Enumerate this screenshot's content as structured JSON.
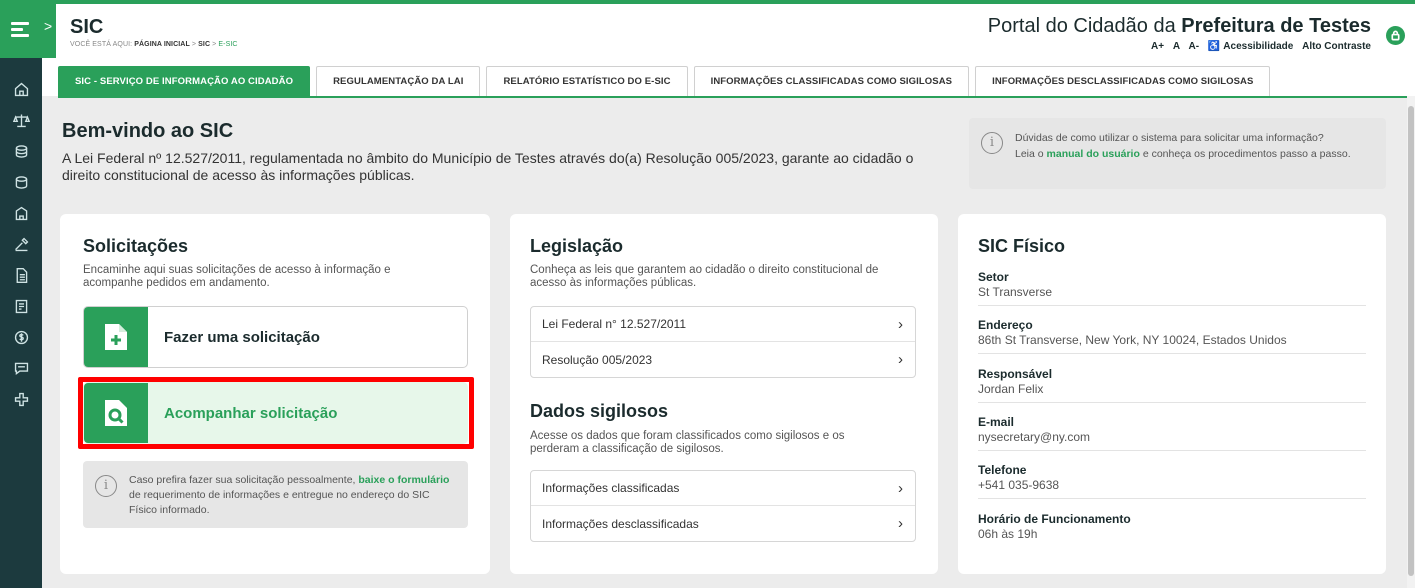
{
  "header": {
    "title": "SIC",
    "breadcrumb_prefix": "VOCÊ ESTÁ AQUI:",
    "breadcrumb_home": "PÁGINA INICIAL",
    "breadcrumb_sep": ">",
    "breadcrumb_sic": "SIC",
    "breadcrumb_current": "E-SIC",
    "portal_prefix": "Portal do Cidadão da",
    "portal_name": "Prefeitura de Testes",
    "a_plus": "A+",
    "a_normal": "A",
    "a_minus": "A-",
    "acc_icon": "♿",
    "accessibility": "Acessibilidade",
    "contrast": "Alto Contraste"
  },
  "tabs": [
    {
      "label": "SIC - SERVIÇO DE INFORMAÇÃO AO CIDADÃO"
    },
    {
      "label": "REGULAMENTAÇÃO DA LAI"
    },
    {
      "label": "RELATÓRIO ESTATÍSTICO DO E-SIC"
    },
    {
      "label": "INFORMAÇÕES CLASSIFICADAS COMO SIGILOSAS"
    },
    {
      "label": "INFORMAÇÕES DESCLASSIFICADAS COMO SIGILOSAS"
    }
  ],
  "welcome": {
    "title": "Bem-vindo ao SIC",
    "text": "A Lei Federal nº 12.527/2011, regulamentada no âmbito do Município de Testes através do(a) Resolução 005/2023, garante ao cidadão o direito constitucional de acesso às informações públicas."
  },
  "help": {
    "line1": "Dúvidas de como utilizar o sistema para solicitar uma informação?",
    "leia": "Leia o",
    "link": "manual do usuário",
    "rest": "e conheça os procedimentos passo a passo."
  },
  "solicitacoes": {
    "title": "Solicitações",
    "desc1": "Encaminhe aqui suas solicitações de acesso à informação e",
    "desc2": "acompanhe pedidos em andamento.",
    "action1": "Fazer uma solicitação",
    "action2": "Acompanhar solicitação",
    "personal_pre": "Caso prefira fazer sua solicitação pessoalmente,",
    "personal_link": "baixe o formulário",
    "personal_post": "de requerimento de informações e entregue no endereço do SIC Físico informado."
  },
  "legislacao": {
    "title": "Legislação",
    "desc1": "Conheça as leis que garantem ao cidadão o direito constitucional de",
    "desc2": "acesso às informações públicas.",
    "items": [
      "Lei Federal n° 12.527/2011",
      "Resolução 005/2023"
    ]
  },
  "sigilosos": {
    "title": "Dados sigilosos",
    "desc1": "Acesse os dados que foram classificados como sigilosos e os",
    "desc2": "perderam a classificação de sigilosos.",
    "items": [
      "Informações classificadas",
      "Informações desclassificadas"
    ]
  },
  "sic_fisico": {
    "title": "SIC Físico",
    "fields": [
      {
        "k": "Setor",
        "v": "St Transverse"
      },
      {
        "k": "Endereço",
        "v": "86th St Transverse, New York, NY 10024, Estados Unidos"
      },
      {
        "k": "Responsável",
        "v": "Jordan Felix"
      },
      {
        "k": "E-mail",
        "v": "nysecretary@ny.com"
      },
      {
        "k": "Telefone",
        "v": "+541 035-9638"
      },
      {
        "k": "Horário de Funcionamento",
        "v": "06h às 19h"
      }
    ]
  },
  "glyphs": {
    "chevron": "›",
    "rail_chevron": ">",
    "info": "i"
  },
  "colors": {
    "brand": "#2aa05a",
    "rail": "#1c3a3e",
    "highlight": "#ff0000"
  }
}
